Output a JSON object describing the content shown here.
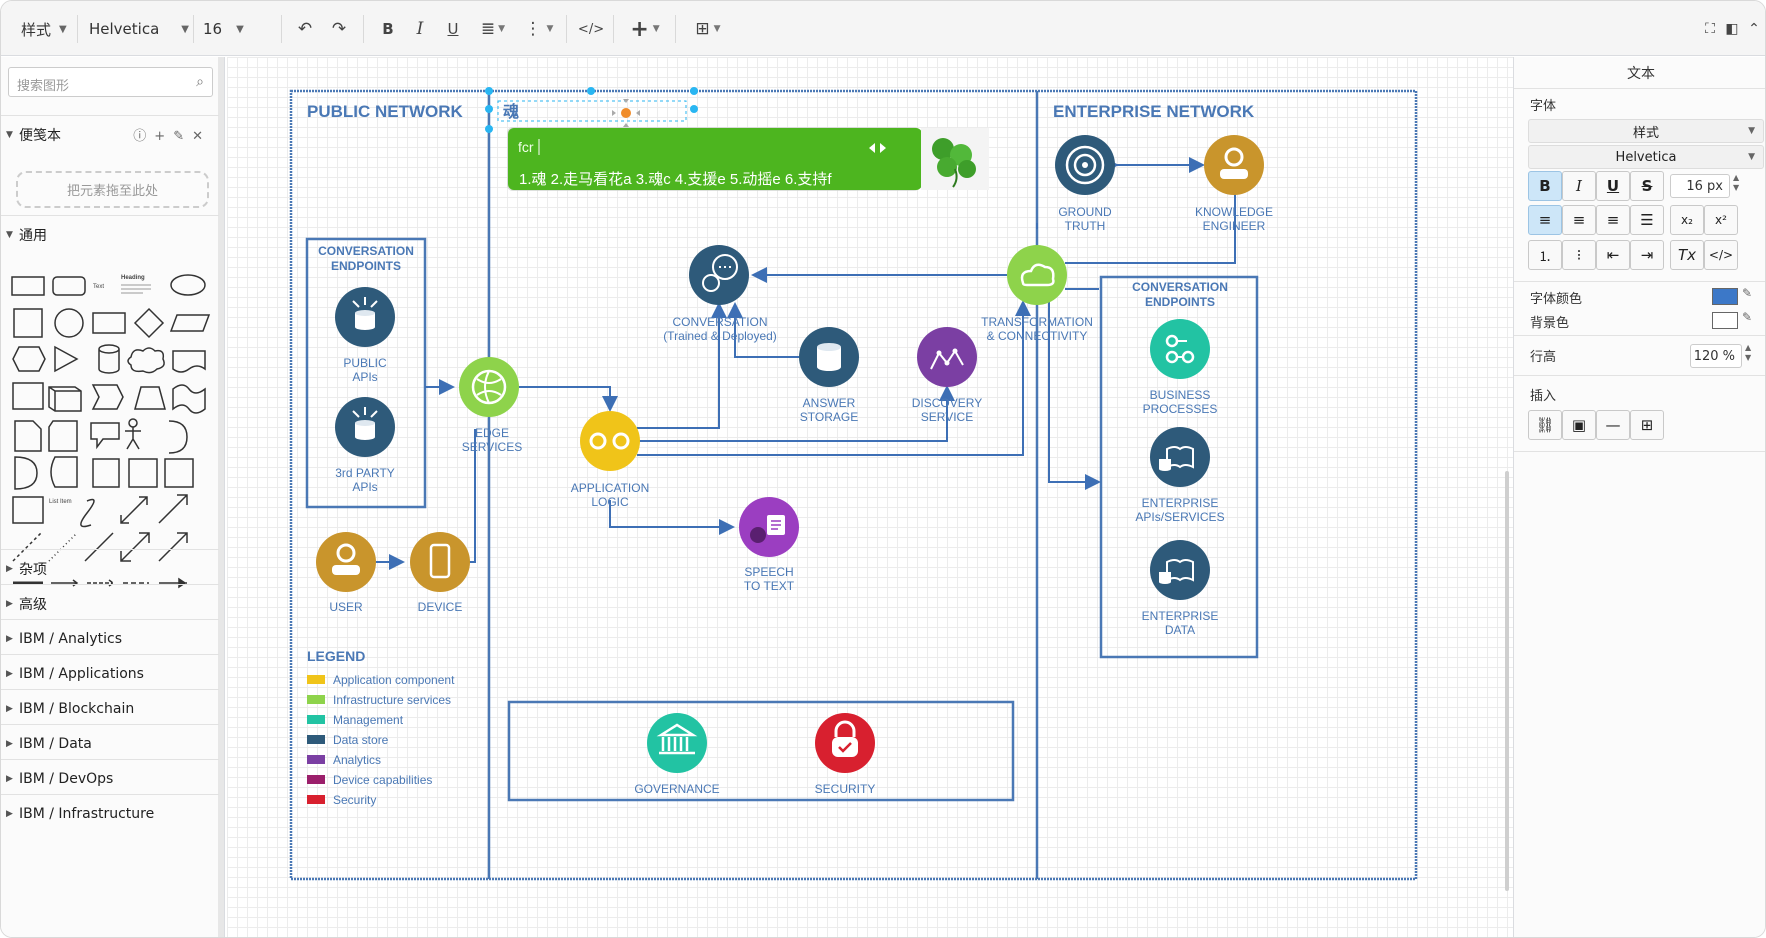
{
  "toolbar": {
    "style_label": "样式",
    "font_label": "Helvetica",
    "size_label": "16",
    "undo_icon": "undo-icon",
    "redo_icon": "redo-icon"
  },
  "left_panel": {
    "search_placeholder": "搜索图形",
    "scratchpad_title": "便笺本",
    "dropzone_label": "把元素拖至此处",
    "general_title": "通用",
    "shape_text_label": "Text",
    "shape_heading_label": "Heading",
    "shape_list_label": "List Item",
    "sections": [
      "杂项",
      "高级",
      "IBM / Analytics",
      "IBM / Applications",
      "IBM / Blockchain",
      "IBM / Data",
      "IBM / DevOps",
      "IBM / Infrastructure"
    ]
  },
  "diagram": {
    "public_title": "PUBLIC NETWORK",
    "enterprise_title": "ENTERPRISE NETWORK",
    "editing_text": "魂",
    "ime": {
      "input": "fcr",
      "candidates": "1.魂 2.走马看花a 3.魂c 4.支援e 5.动摇e 6.支持f"
    },
    "conv_endpoints_left": [
      "CONVERSATION",
      "ENDPOINTS"
    ],
    "public_apis": [
      "PUBLIC",
      "APIs"
    ],
    "third_party_apis": [
      "3rd PARTY",
      "APIs"
    ],
    "edge_services": [
      "EDGE",
      "SERVICES"
    ],
    "user": "USER",
    "device": "DEVICE",
    "conversation": [
      "CONVERSATION",
      "(Trained & Deployed)"
    ],
    "answer_storage": [
      "ANSWER",
      "STORAGE"
    ],
    "discovery_service": [
      "DISCOVERY",
      "SERVICE"
    ],
    "application_logic": [
      "APPLICATION",
      "LOGIC"
    ],
    "speech_to_text": [
      "SPEECH",
      "TO TEXT"
    ],
    "ground_truth": [
      "GROUND",
      "TRUTH"
    ],
    "knowledge_engineer": [
      "KNOWLEDGE",
      "ENGINEER"
    ],
    "transformation": [
      "TRANSFORMATION",
      "& CONNECTIVITY"
    ],
    "conv_endpoints_right": [
      "CONVERSATION",
      "ENDPOINTS"
    ],
    "business_processes": [
      "BUSINESS",
      "PROCESSES"
    ],
    "enterprise_apis": [
      "ENTERPRISE",
      "APIs/SERVICES"
    ],
    "enterprise_data": [
      "ENTERPRISE",
      "DATA"
    ],
    "governance": "GOVERNANCE",
    "security": "SECURITY",
    "legend_title": "LEGEND",
    "legend": [
      {
        "label": "Application component",
        "color": "#f0c419"
      },
      {
        "label": "Infrastructure services",
        "color": "#8ed34b"
      },
      {
        "label": "Management",
        "color": "#22c3a3"
      },
      {
        "label": "Data store",
        "color": "#2e5a7a"
      },
      {
        "label": "Analytics",
        "color": "#7b3fa3"
      },
      {
        "label": "Device capabilities",
        "color": "#9b1f6b"
      },
      {
        "label": "Security",
        "color": "#d8202f"
      }
    ]
  },
  "right_panel": {
    "title": "文本",
    "font_section": "字体",
    "style_select": "样式",
    "font_select": "Helvetica",
    "font_size": "16 px",
    "font_color_label": "字体颜色",
    "bg_color_label": "背景色",
    "font_color": "#3c78c8",
    "line_height_label": "行高",
    "line_height": "120 %",
    "insert_label": "插入"
  },
  "colors": {
    "frame": "#4a78b5",
    "title_text": "#4a78b5",
    "connector": "#3d6fb5"
  }
}
